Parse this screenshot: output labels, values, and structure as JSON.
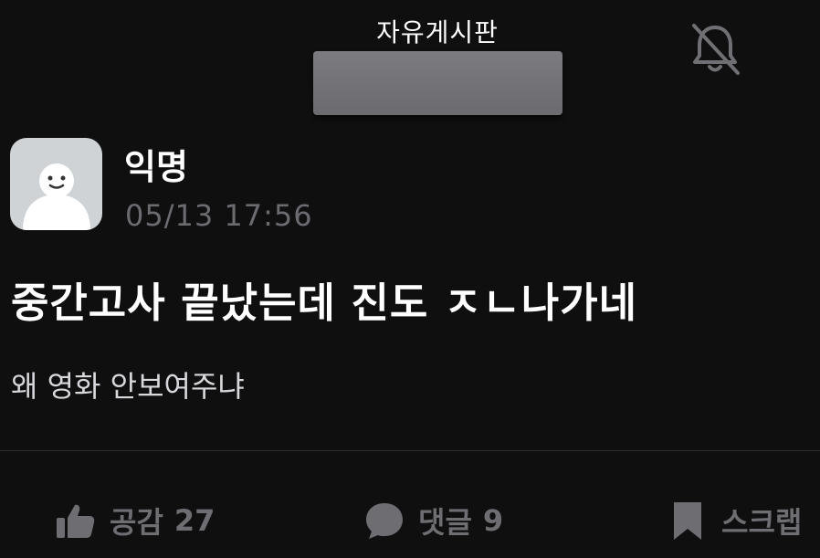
{
  "header": {
    "board_title": "자유게시판",
    "notification_icon": "bell-off-icon"
  },
  "post": {
    "author": "익명",
    "timestamp": "05/13 17:56",
    "title": "중간고사 끝났는데 진도 ㅈㄴ나가네",
    "body": "왜 영화 안보여주냐",
    "avatar_icon": "anonymous-avatar-icon"
  },
  "actions": {
    "like": {
      "label": "공감",
      "count": "27",
      "icon": "thumbs-up-icon"
    },
    "comment": {
      "label": "댓글",
      "count": "9",
      "icon": "speech-bubble-icon"
    },
    "scrap": {
      "label": "스크랩",
      "icon": "bookmark-icon"
    }
  },
  "colors": {
    "background": "#0f0f10",
    "text_primary": "#ffffff",
    "text_muted": "#6b6b70",
    "avatar_bg": "#cfd3d6"
  }
}
